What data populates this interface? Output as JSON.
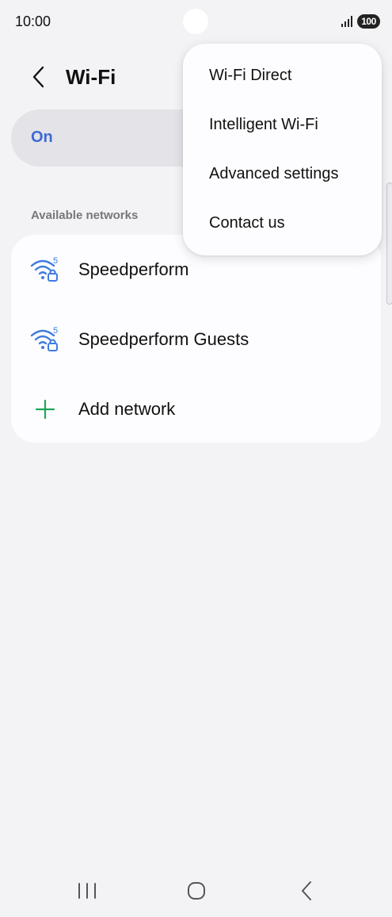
{
  "status_bar": {
    "time": "10:00",
    "battery": "100",
    "icons": [
      "signal-icon",
      "battery-icon"
    ]
  },
  "header": {
    "title": "Wi-Fi",
    "back_icon": "back-arrow-icon"
  },
  "master_toggle": {
    "label": "On"
  },
  "networks": {
    "section_title": "Available networks",
    "items": [
      {
        "name": "Speedperform",
        "icon": "wifi-5ghz-locked-icon"
      },
      {
        "name": "Speedperform Guests",
        "icon": "wifi-5ghz-locked-icon"
      }
    ],
    "add_label": "Add network",
    "add_icon": "plus-icon"
  },
  "overflow_menu": {
    "items": [
      {
        "label": "Wi-Fi Direct"
      },
      {
        "label": "Intelligent Wi-Fi"
      },
      {
        "label": "Advanced settings"
      },
      {
        "label": "Contact us"
      }
    ]
  },
  "nav_bar": {
    "icons": [
      "recents-icon",
      "home-icon",
      "back-icon"
    ]
  },
  "colors": {
    "accent_blue": "#3e6ad6",
    "wifi_blue": "#3f7be0",
    "add_green": "#1fa65a",
    "background": "#f3f3f6",
    "card": "#fdfdff"
  }
}
